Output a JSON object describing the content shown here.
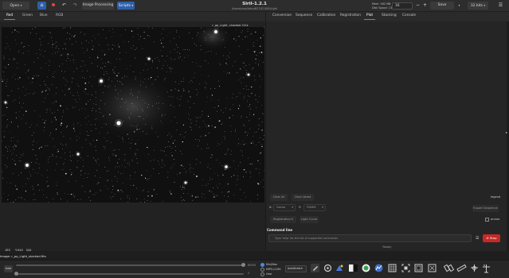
{
  "header": {
    "open_label": "Open",
    "image_processing_label": "Image Processing",
    "scripts_label": "Scripts",
    "title": "Siril-1.2.1",
    "subtitle": "/home/user/Astro/M27/IC1805/Light",
    "mem": "Mem: 562 MB",
    "disk": "Disk Space: 135 GB",
    "threads": "16",
    "save_label": "Save",
    "bits_label": "32 bits"
  },
  "channel_tabs": [
    "Red",
    "Green",
    "Blue",
    "RGB"
  ],
  "image": {
    "filename": "r_pp_Light_stacked.fits",
    "coord_x": "185",
    "coord_y": "Y:444",
    "coord_value": "N/A",
    "status": "Image: r_pp_Light_stacked.fits"
  },
  "right_tabs": [
    "Conversion",
    "Sequence",
    "Calibration",
    "Registration",
    "Plot",
    "Stacking",
    "Console"
  ],
  "right_active_tab": "Plot",
  "plot": {
    "clear_all": "Clear all",
    "clear_latest": "Clear latest",
    "legend": "legend",
    "x_label": "X:",
    "x_value": "Frame",
    "y_label": "Y:",
    "y_value": "FWHM",
    "registration_label": "Registration",
    "light_curve_label": "Light Curve",
    "julian_label": "Julian",
    "export_label": "Export",
    "sequence_label": "Sequence",
    "julian_date_label": "Julian",
    "sorting_value": "arcsec"
  },
  "command": {
    "label": "Command line",
    "placeholder": "Type 'help' for the list of supported commands",
    "stop_label": "Stop",
    "status": "Ready"
  },
  "bottom": {
    "auto_label": "Auto",
    "slider_max": "65535",
    "slider_min": "0",
    "radio_options": [
      "Min/Max",
      "MIPS-LO/HI",
      "User"
    ],
    "stretch_value": "AutoStretch"
  },
  "colors": {
    "accent": "#2f5fa8",
    "stop": "#c62828"
  },
  "icons": {
    "home": "home-icon",
    "record": "record-icon",
    "undo": "undo-icon",
    "redo": "redo-icon",
    "menu": "hamburger-menu-icon",
    "tools": [
      "pencil-icon",
      "starfinder-icon",
      "photometry-icon",
      "negative-icon",
      "color-wheel-icon",
      "histogram-icon",
      "grid-icon",
      "roi-icon",
      "frame-icon",
      "crop-icon",
      "mirror-icon",
      "ruler-icon",
      "annotation-icon",
      "compass-icon"
    ]
  }
}
